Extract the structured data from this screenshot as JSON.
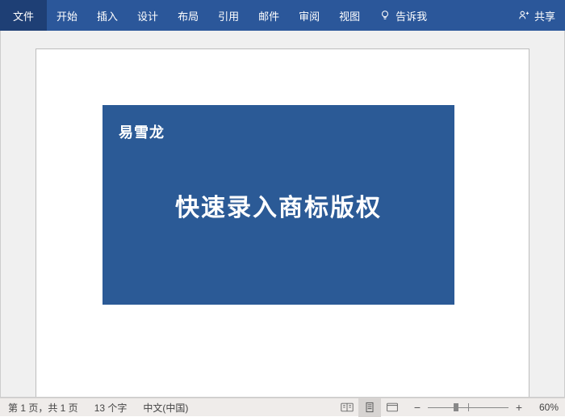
{
  "ribbon": {
    "file": "文件",
    "tabs": [
      "开始",
      "插入",
      "设计",
      "布局",
      "引用",
      "邮件",
      "审阅",
      "视图"
    ],
    "tellme": "告诉我",
    "share": "共享"
  },
  "document": {
    "brand": "易雪龙",
    "headline": "快速录入商标版权"
  },
  "status": {
    "page": "第 1 页，共 1 页",
    "words": "13 个字",
    "language": "中文(中国)",
    "zoom_pct": "60%",
    "zoom_thumb_position_pct": 35
  }
}
